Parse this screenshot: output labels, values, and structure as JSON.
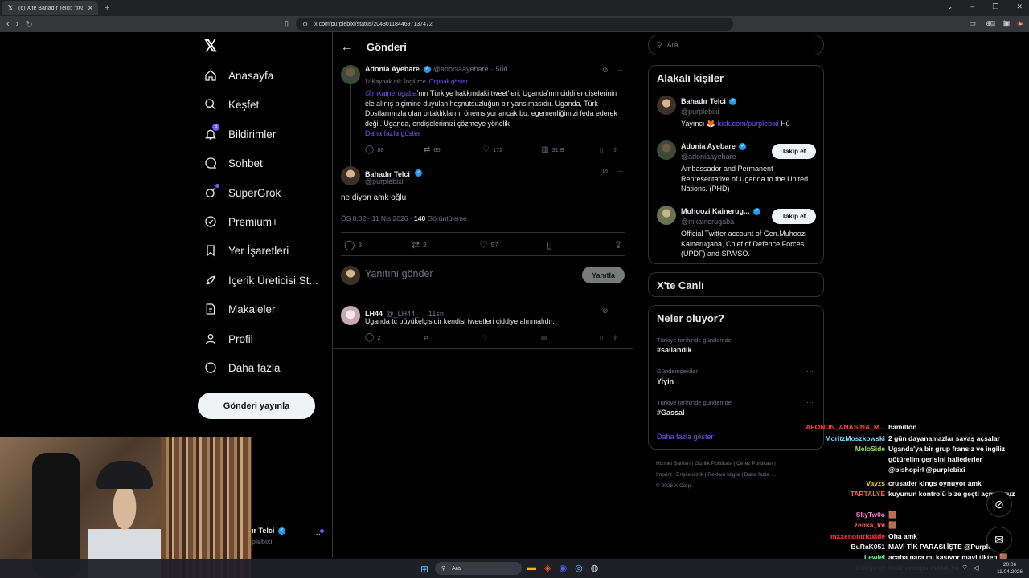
{
  "browser": {
    "tab_title": "(6) X'te Bahadır Telci: \"@adonia…",
    "url": "x.com/purplebixi/status/2043011844697137472"
  },
  "sidebar": {
    "items": [
      {
        "label": "Anasayfa",
        "icon": "home-icon"
      },
      {
        "label": "Keşfet",
        "icon": "search-icon"
      },
      {
        "label": "Bildirimler",
        "icon": "bell-icon",
        "badge": "6"
      },
      {
        "label": "Sohbet",
        "icon": "chat-icon"
      },
      {
        "label": "SuperGrok",
        "icon": "grok-icon"
      },
      {
        "label": "Premium+",
        "icon": "premium-icon"
      },
      {
        "label": "Yer İşaretleri",
        "icon": "bookmark-icon"
      },
      {
        "label": "İçerik Üreticisi St...",
        "icon": "rocket-icon"
      },
      {
        "label": "Makaleler",
        "icon": "article-icon"
      },
      {
        "label": "Profil",
        "icon": "profile-icon"
      },
      {
        "label": "Daha fazla",
        "icon": "more-icon"
      }
    ],
    "post_button": "Gönderi yayınla",
    "account_name": "ır Telci",
    "account_handle": "plebixi"
  },
  "main": {
    "header_title": "Gönderi",
    "quoted_tweet": {
      "name": "Adonia Ayebare",
      "handle": "@adoniaayebare",
      "time": "50d",
      "translated_note": "Kaynak dili: İngilizce",
      "show_original": "Orijinali göster",
      "mention": "@mkainerugaba",
      "body": "'nın Türkiye hakkındaki tweet'leri, Uganda'nın ciddi endişelerinin ele alınış biçimine duyulan hoşnutsuzluğun bir yansımasıdır. Uganda, Türk Dostlarımızla olan ortaklıklarını önemsiyor ancak bu, egemenliğimizi feda ederek değil. Uganda, endişelerimizi çözmeye yönelik",
      "show_more": "Daha fazla göster",
      "replies": "88",
      "retweets": "65",
      "likes": "172",
      "views": "31 B"
    },
    "main_tweet": {
      "name": "Bahadır Telci",
      "handle": "@purplebixi",
      "body": "ne diyon amk oğlu",
      "timestamp": "ÖS 8:02 · 11 Nis 2026 · ",
      "views": "140",
      "views_label": " Görüntüleme",
      "replies": "3",
      "retweets": "2",
      "likes": "57"
    },
    "reply_placeholder": "Yanıtını gönder",
    "reply_button": "Yanıtla",
    "reply_tweet": {
      "name": "LH44",
      "handle": "@_LH44_",
      "time": "11sn",
      "body": "Uganda tc büyükelçisidir kendisi tweetleri ciddiye alınmalıdır.",
      "replies": "2"
    }
  },
  "right": {
    "search_placeholder": "Ara",
    "related_title": "Alakalı kişiler",
    "people": [
      {
        "name": "Bahadır Telci",
        "handle": "@purplebixi",
        "bio_prefix": "Yayıncı 🦊 ",
        "bio_link": "kick.com/purplebixi",
        "bio_suffix": " Hü"
      },
      {
        "name": "Adonia Ayebare",
        "handle": "@adoniaayebare",
        "bio": "Ambassador and Permanent Representative of Uganda to the United Nations. (PHD)",
        "follow": "Takip et"
      },
      {
        "name": "Muhoozi Kainerug...",
        "handle": "@mkainerugaba",
        "bio": "Official Twitter account of Gen.Muhoozi Kainerugaba, Chief of Defence Forces (UPDF) and SPA/SO.",
        "follow": "Takip et"
      }
    ],
    "live_title": "X'te Canlı",
    "trends_title": "Neler oluyor?",
    "trends": [
      {
        "category": "Türkiye tarihinde gündemde",
        "name": "#sallandık"
      },
      {
        "category": "Gündemdekiler",
        "name": "Yiyin"
      },
      {
        "category": "Türkiye tarihinde gündemde",
        "name": "#Gassal"
      }
    ],
    "trends_more": "Daha fazla göster",
    "footer_line1": "Hizmet Şartları  |  Gizlilik Politikası  |  Çerez Politikası  |",
    "footer_line2": "Imprint  |  Erişilebilirlik  |  Reklam bilgisi  |  Daha fazla …",
    "footer_line3": "© 2026 X Corp."
  },
  "chat": [
    {
      "user": "AFONUN_ANASINA_M...",
      "color": "#ff4040",
      "msg": "hamilton"
    },
    {
      "user": "MoritzMoszkowski",
      "color": "#7fd7ff",
      "msg": "2 gün dayanamazlar savaş açsalar"
    },
    {
      "user": "MeloSide",
      "color": "#9bd96b",
      "msg": "Uganda'ya bir grup fransız ve ingiliz götürelim gerisini hallederler @bishopirl @purplebixi"
    },
    {
      "user": "Vayzs",
      "color": "#ffcc33",
      "msg": "crusader kings oynuyor amk"
    },
    {
      "user": "TARTALYE",
      "color": "#ff5b5b",
      "msg": "kuyunun kontrolü bize geçti açmıyoruz"
    },
    {
      "user": "SkyTw0o",
      "color": "#ff7bd6",
      "msg": "🟫"
    },
    {
      "user": "zenka_lol",
      "color": "#ff5b5b",
      "msg": "🟫"
    },
    {
      "user": "mxxenontrioxide",
      "color": "#ff4040",
      "msg": "Oha amk"
    },
    {
      "user": "BuRaK051",
      "color": "#e7e9ea",
      "msg": "MAVİ TİK PARASI İŞTE @PurpleBixi"
    },
    {
      "user": "Lewiel",
      "color": "#6bff9c",
      "msg": "acaba para mı kasıyor mavi tikten 🟫"
    },
    {
      "user": "eskigiray",
      "color": "#7fd7ff",
      "msg": "işsiz orospu evladı ya"
    }
  ],
  "taskbar": {
    "search": "Ara",
    "time": "20:06",
    "date": "11.04.2026"
  }
}
